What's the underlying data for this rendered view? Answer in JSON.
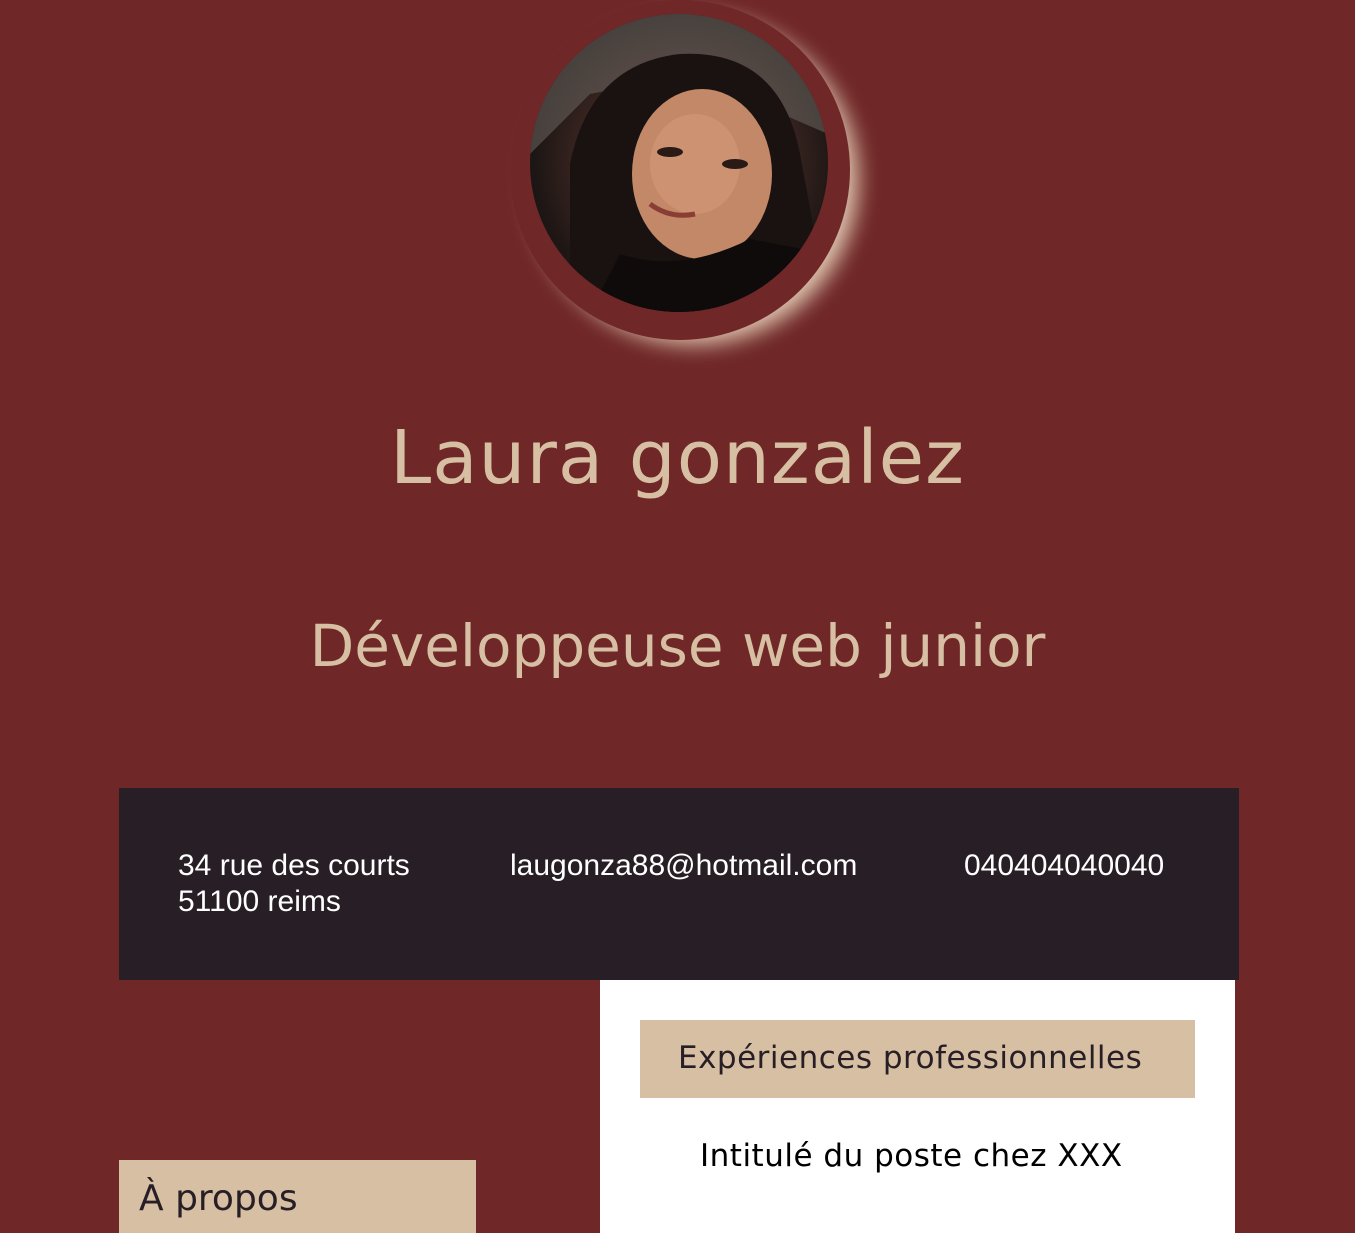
{
  "profile": {
    "name": "Laura gonzalez",
    "role": "Développeuse web junior",
    "photo_icon": "profile-photo"
  },
  "contact": {
    "address_line1": "34 rue des courts",
    "address_line2": "51100 reims",
    "email": "laugonza88@hotmail.com",
    "phone": "040404040040"
  },
  "sections": {
    "experience_title": "Expériences professionnelles",
    "experience_job": "Intitulé du poste chez XXX",
    "about_title": "À propos"
  },
  "colors": {
    "background": "#6f2727",
    "accent": "#d7bfa3",
    "dark": "#271f25",
    "card": "#ffffff"
  }
}
